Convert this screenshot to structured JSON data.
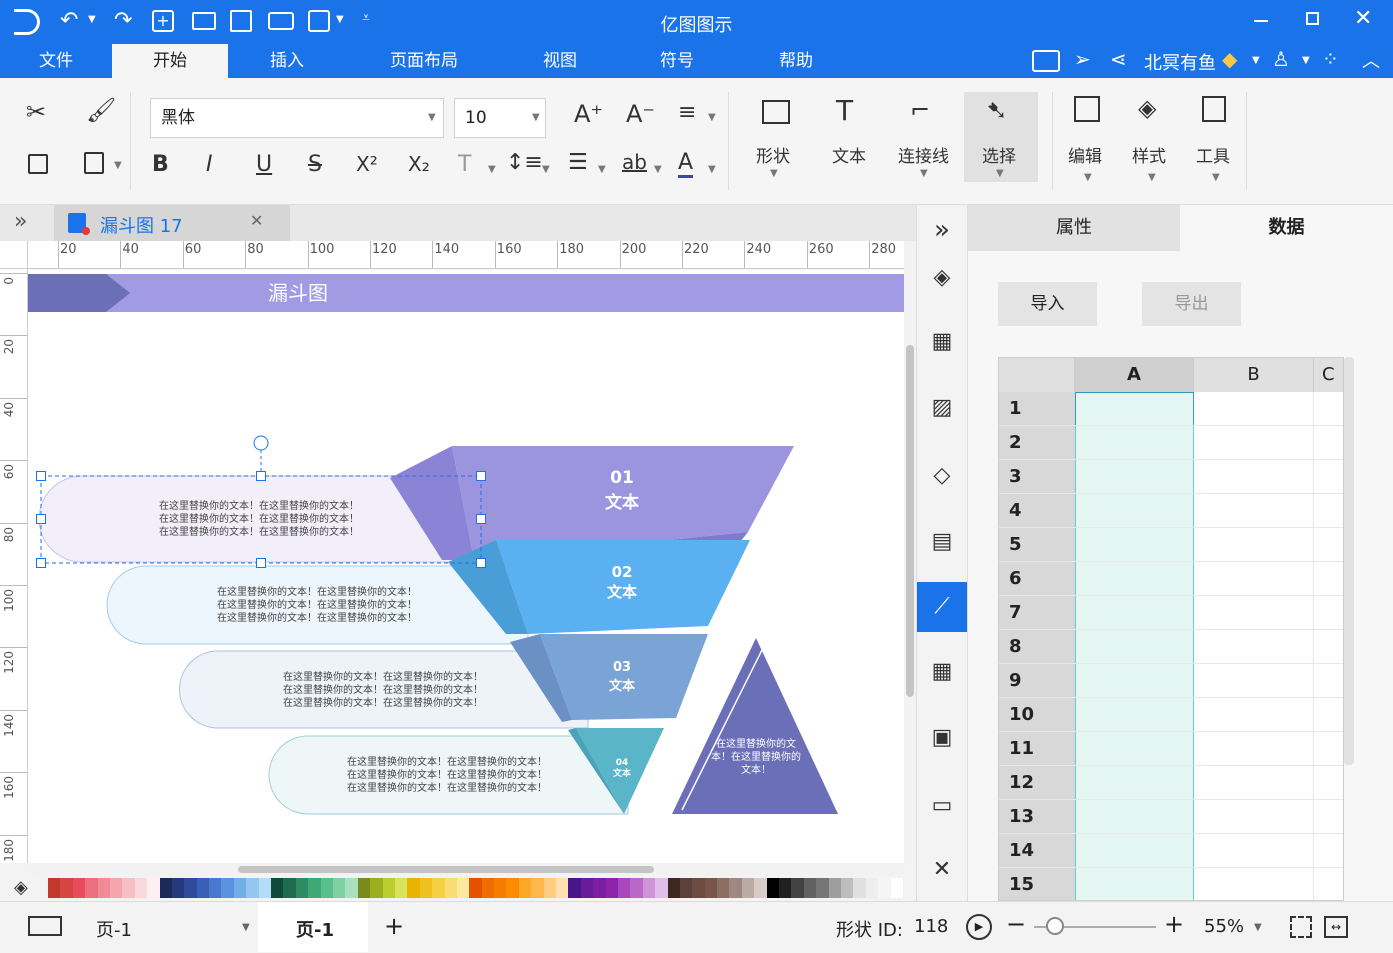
{
  "app": {
    "title": "亿图图示",
    "window_controls": [
      "minimize-icon",
      "maximize-icon",
      "close-icon"
    ]
  },
  "menu": {
    "tabs": [
      "文件",
      "开始",
      "插入",
      "页面布局",
      "视图",
      "符号",
      "帮助"
    ],
    "active": "开始",
    "user": "北冥有鱼"
  },
  "ribbon": {
    "font_name": "黑体",
    "font_size": "10",
    "shape_label": "形状",
    "text_label": "文本",
    "connector_label": "连接线",
    "select_label": "选择",
    "edit_label": "编辑",
    "style_label": "样式",
    "tools_label": "工具"
  },
  "doc": {
    "tab_title": "漏斗图 17",
    "ruler_h": [
      "20",
      "40",
      "60",
      "80",
      "100",
      "120",
      "140",
      "160",
      "180",
      "200",
      "220",
      "240",
      "260",
      "280"
    ],
    "ruler_v": [
      "0",
      "20",
      "40",
      "60",
      "80",
      "100",
      "120",
      "140",
      "160",
      "180"
    ]
  },
  "diagram": {
    "header_title": "漏斗图",
    "layers": [
      {
        "num": "01",
        "label": "文本",
        "color": "#9b95e0"
      },
      {
        "num": "02",
        "label": "文本",
        "color": "#5ab0f0"
      },
      {
        "num": "03",
        "label": "文本",
        "color": "#7aa3d6"
      },
      {
        "num": "04",
        "label": "文本",
        "color": "#5bb5c9"
      }
    ],
    "placeholder": "在这里替换你的文本！在这里替换你的文本！",
    "triangle_text": "在这里替换你的文本！在这里替换你的文本！"
  },
  "panel": {
    "tab_properties": "属性",
    "tab_data": "数据",
    "import_label": "导入",
    "export_label": "导出",
    "columns": [
      "A",
      "B",
      "C"
    ],
    "rows": [
      "1",
      "2",
      "3",
      "4",
      "5",
      "6",
      "7",
      "8",
      "9",
      "10",
      "11",
      "12",
      "13",
      "14",
      "15"
    ]
  },
  "status": {
    "page_select": "页-1",
    "page_tab": "页-1",
    "shape_id_label": "形状 ID:",
    "shape_id": "118",
    "zoom": "55%"
  }
}
